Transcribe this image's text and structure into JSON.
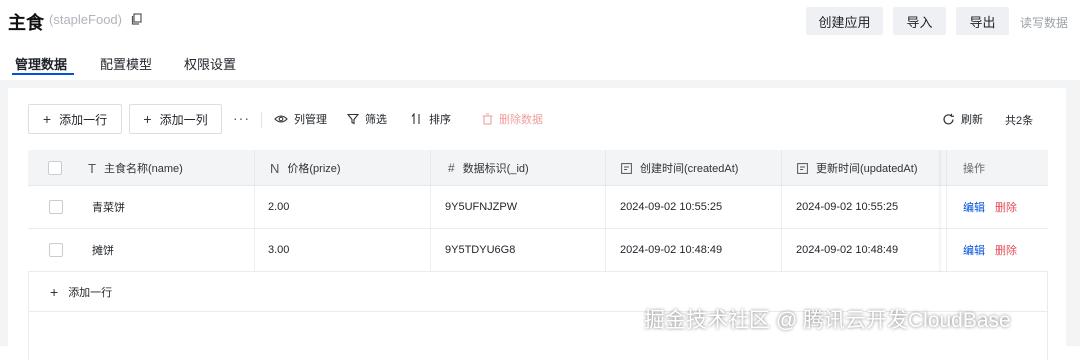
{
  "header": {
    "title": "主食",
    "subtitle": "(stapleFood)",
    "buttons": {
      "create_app": "创建应用",
      "import": "导入",
      "export": "导出"
    },
    "rw_label": "读写数据"
  },
  "tabs": [
    {
      "label": "管理数据",
      "active": true
    },
    {
      "label": "配置模型",
      "active": false
    },
    {
      "label": "权限设置",
      "active": false
    }
  ],
  "toolbar": {
    "add_row": "添加一行",
    "add_col": "添加一列",
    "more": "···",
    "col_manage": "列管理",
    "filter": "筛选",
    "sort": "排序",
    "delete": "删除数据",
    "refresh": "刷新",
    "total": "共2条"
  },
  "table": {
    "columns": [
      {
        "label": "主食名称(name)",
        "icon": "text-type-icon"
      },
      {
        "label": "价格(prize)",
        "icon": "number-type-icon"
      },
      {
        "label": "数据标识(_id)",
        "icon": "hash-icon"
      },
      {
        "label": "创建时间(createdAt)",
        "icon": "calendar-icon"
      },
      {
        "label": "更新时间(updatedAt)",
        "icon": "calendar-icon"
      },
      {
        "label": "操作",
        "icon": ""
      }
    ],
    "rows": [
      {
        "name": "青菜饼",
        "prize": "2.00",
        "id": "9Y5UFNJZPW",
        "created": "2024-09-02 10:55:25",
        "updated": "2024-09-02 10:55:25",
        "edit": "编辑",
        "del": "删除"
      },
      {
        "name": "摊饼",
        "prize": "3.00",
        "id": "9Y5TDYU6G8",
        "created": "2024-09-02 10:48:49",
        "updated": "2024-09-02 10:48:49",
        "edit": "编辑",
        "del": "删除"
      }
    ],
    "add_row_footer": "添加一行"
  },
  "watermark": "掘金技术社区 @ 腾讯云开发CloudBase",
  "colors": {
    "accent": "#0052d9",
    "danger": "#e34d59",
    "background": "#f3f4f6"
  }
}
